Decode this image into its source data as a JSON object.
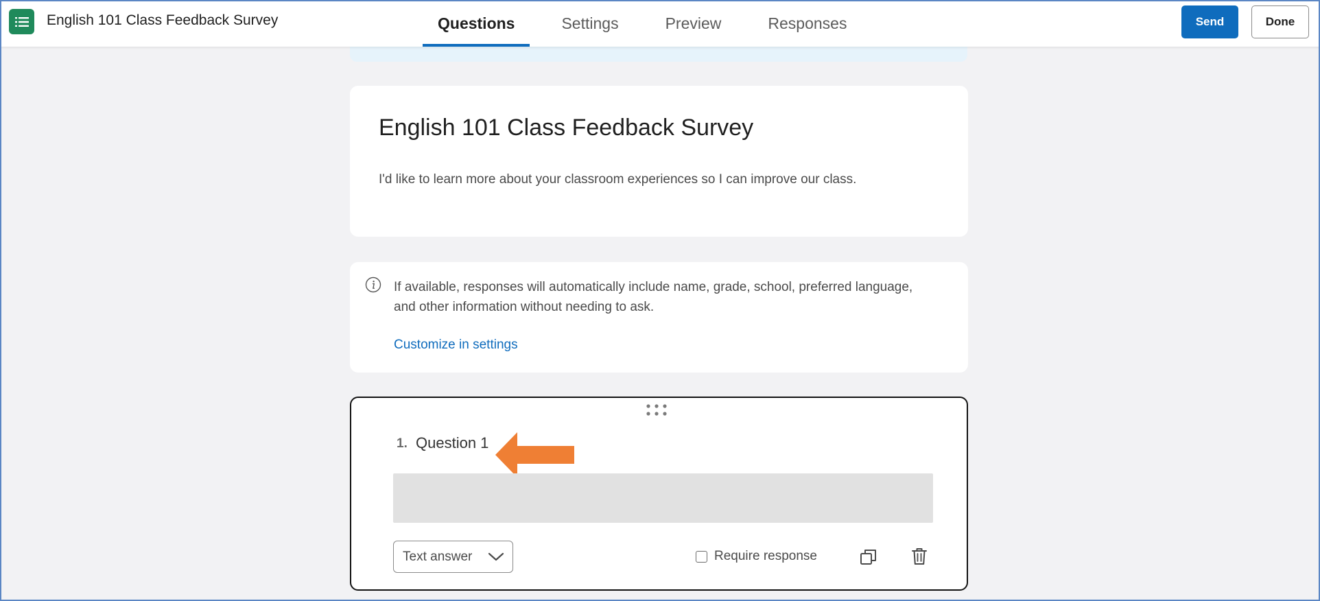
{
  "header": {
    "app_icon": "list-icon",
    "doc_title": "English 101 Class Feedback Survey",
    "tabs": [
      {
        "label": "Questions",
        "active": true
      },
      {
        "label": "Settings",
        "active": false
      },
      {
        "label": "Preview",
        "active": false
      },
      {
        "label": "Responses",
        "active": false
      }
    ],
    "send_label": "Send",
    "done_label": "Done"
  },
  "form": {
    "title": "English 101 Class Feedback Survey",
    "description": "I'd like to learn more about your classroom experiences so I can improve our class."
  },
  "info": {
    "icon": "info-icon",
    "text": "If available, responses will automatically include name, grade, school, preferred language, and other information without needing to ask.",
    "link": "Customize in settings"
  },
  "question": {
    "number": "1.",
    "title": "Question 1",
    "type": "Text answer",
    "require_label": "Require response",
    "required": false
  },
  "colors": {
    "accent": "#0f6cbd",
    "app_green": "#1f8a5b",
    "annotation_arrow": "#ef7f34",
    "page_bg": "#f2f2f4"
  }
}
